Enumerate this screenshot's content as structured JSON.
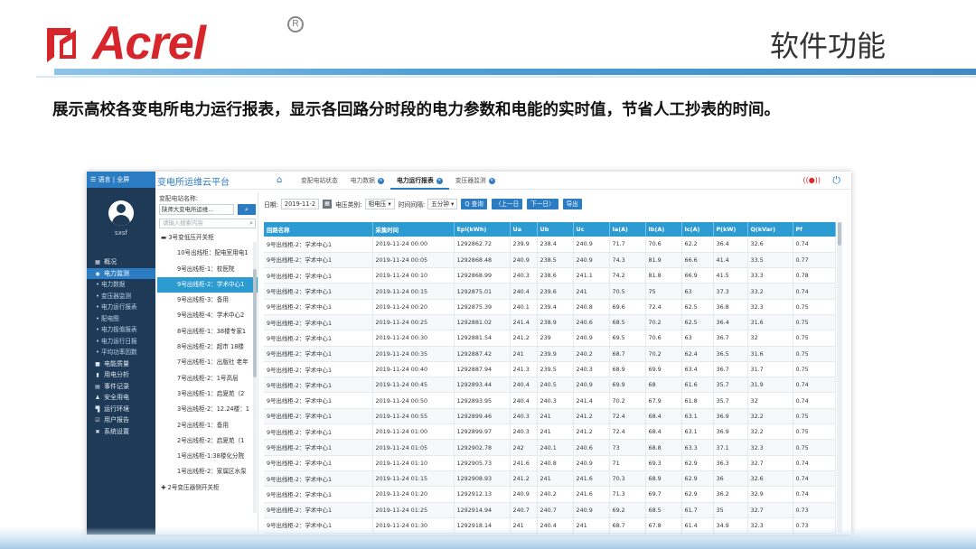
{
  "slide": {
    "logo_text": "Acrel",
    "logo_registered": "R",
    "title": "软件功能",
    "description": "展示高校各变电所电力运行报表，显示各回路分时段的电力参数和电能的实时值，节省人工抄表的时间。",
    "colors": {
      "brand_red": "#d6262b",
      "accent_blue": "#2b7cc3",
      "header_blue": "#2b9bd1",
      "sidebar": "#1f3a56"
    }
  },
  "app": {
    "sidebar": {
      "top_label": "☰ 语言 | 全屏",
      "username": "sxsf",
      "menu": [
        {
          "label": "概况",
          "icon": "dashboard-icon",
          "glyph": "▦",
          "sub": false,
          "active": false
        },
        {
          "label": "电力监测",
          "icon": "monitor-icon",
          "glyph": "◉",
          "sub": false,
          "active": true
        },
        {
          "label": "• 电力数据",
          "icon": "",
          "glyph": "",
          "sub": true,
          "active": false
        },
        {
          "label": "• 变压器监测",
          "icon": "",
          "glyph": "",
          "sub": true,
          "active": false
        },
        {
          "label": "• 电力运行报表",
          "icon": "",
          "glyph": "",
          "sub": true,
          "active": false
        },
        {
          "label": "• 配电图",
          "icon": "",
          "glyph": "",
          "sub": true,
          "active": false
        },
        {
          "label": "• 电力极值报表",
          "icon": "",
          "glyph": "",
          "sub": true,
          "active": false
        },
        {
          "label": "• 电力运行日报",
          "icon": "",
          "glyph": "",
          "sub": true,
          "active": false
        },
        {
          "label": "• 平均功率因数",
          "icon": "",
          "glyph": "",
          "sub": true,
          "active": false
        },
        {
          "label": "电能质量",
          "icon": "power-quality-icon",
          "glyph": "■",
          "sub": false,
          "active": false
        },
        {
          "label": "用电分析",
          "icon": "analysis-icon",
          "glyph": "▮",
          "sub": false,
          "active": false
        },
        {
          "label": "事件记录",
          "icon": "event-icon",
          "glyph": "▤",
          "sub": false,
          "active": false
        },
        {
          "label": "安全用电",
          "icon": "safety-icon",
          "glyph": "♟",
          "sub": false,
          "active": false
        },
        {
          "label": "运行环境",
          "icon": "environment-icon",
          "glyph": "▜",
          "sub": false,
          "active": false
        },
        {
          "label": "用户报告",
          "icon": "report-icon",
          "glyph": "☑",
          "sub": false,
          "active": false
        },
        {
          "label": "系统设置",
          "icon": "settings-icon",
          "glyph": "✖",
          "sub": false,
          "active": false
        }
      ]
    },
    "topbar": {
      "platform_name": "变电所运维云平台",
      "tabs": [
        {
          "label": "变配电站状态",
          "closable": false,
          "active": false
        },
        {
          "label": "电力数据",
          "closable": true,
          "active": false
        },
        {
          "label": "电力运行报表",
          "closable": true,
          "active": true
        },
        {
          "label": "变压器监测",
          "closable": true,
          "active": false
        }
      ]
    },
    "tree": {
      "station_label": "变配电站名称:",
      "station_value": "陕师大变电所运维...",
      "search_placeholder": "请输入搜索内容",
      "nodes": [
        {
          "label": "▬ 3号变低压开关柜",
          "root": true,
          "active": false
        },
        {
          "label": "10号出线柜：配电室用电1",
          "root": false,
          "active": false
        },
        {
          "label": "9号出线柜-1：校医院",
          "root": false,
          "active": false
        },
        {
          "label": "9号出线柜-2：学术中心1",
          "root": false,
          "active": true
        },
        {
          "label": "9号出线柜-3：备用",
          "root": false,
          "active": false
        },
        {
          "label": "9号出线柜-4：学术中心2",
          "root": false,
          "active": false
        },
        {
          "label": "8号出线柜-1：38楼专家1",
          "root": false,
          "active": false
        },
        {
          "label": "8号出线柜-2：超市 18楼",
          "root": false,
          "active": false
        },
        {
          "label": "7号出线柜-1：出版社 老年",
          "root": false,
          "active": false
        },
        {
          "label": "7号出线柜-2：1号高层",
          "root": false,
          "active": false
        },
        {
          "label": "3号出线柜-1：启夏苑（2",
          "root": false,
          "active": false
        },
        {
          "label": "3号出线柜-2：12.24楼：1",
          "root": false,
          "active": false
        },
        {
          "label": "2号出线柜-1：备用",
          "root": false,
          "active": false
        },
        {
          "label": "2号出线柜-2：启夏苑（1",
          "root": false,
          "active": false
        },
        {
          "label": "1号出线柜-1:38楼化分院",
          "root": false,
          "active": false
        },
        {
          "label": "1号出线柜-2：家属区水泵",
          "root": false,
          "active": false
        },
        {
          "label": "✚ 2号变压器侧开关柜",
          "root": true,
          "active": false
        }
      ]
    },
    "toolbar": {
      "date_label": "日期:",
      "date_value": "2019-11-2",
      "type_label": "电压类别:",
      "type_value": "相电压",
      "interval_label": "时间间隔:",
      "interval_value": "五分钟",
      "buttons": [
        "Q 查询",
        "〈上一日",
        "下一日〉",
        "导出"
      ]
    },
    "table": {
      "columns": [
        "回路名称",
        "采集时间",
        "Epi(kWh)",
        "Ua",
        "Ub",
        "Uc",
        "Ia(A)",
        "Ib(A)",
        "Ic(A)",
        "P(kW)",
        "Q(kVar)",
        "Pf"
      ],
      "rows": [
        [
          "9号出线柜-2：学术中心1",
          "2019-11-24 00:00",
          "1292862.72",
          "239.9",
          "238.4",
          "240.9",
          "71.7",
          "70.6",
          "62.2",
          "36.4",
          "32.6",
          "0.74"
        ],
        [
          "9号出线柜-2：学术中心1",
          "2019-11-24 00:05",
          "1292868.48",
          "240.9",
          "238.5",
          "240.9",
          "74.3",
          "81.9",
          "66.6",
          "41.4",
          "33.5",
          "0.77"
        ],
        [
          "9号出线柜-2：学术中心1",
          "2019-11-24 00:10",
          "1292868.99",
          "240.3",
          "238.6",
          "241.1",
          "74.2",
          "81.8",
          "66.9",
          "41.5",
          "33.3",
          "0.78"
        ],
        [
          "9号出线柜-2：学术中心1",
          "2019-11-24 00:15",
          "1292875.01",
          "240.4",
          "239.6",
          "241",
          "70.5",
          "75",
          "63",
          "37.3",
          "33.2",
          "0.74"
        ],
        [
          "9号出线柜-2：学术中心1",
          "2019-11-24 00:20",
          "1292875.39",
          "240.1",
          "239.4",
          "240.8",
          "69.6",
          "72.4",
          "62.5",
          "36.8",
          "32.3",
          "0.75"
        ],
        [
          "9号出线柜-2：学术中心1",
          "2019-11-24 00:25",
          "1292881.02",
          "241.4",
          "238.9",
          "240.6",
          "68.5",
          "70.2",
          "62.5",
          "36.4",
          "31.6",
          "0.75"
        ],
        [
          "9号出线柜-2：学术中心1",
          "2019-11-24 00:30",
          "1292881.54",
          "241.2",
          "239",
          "240.9",
          "69.5",
          "70.6",
          "63",
          "36.7",
          "32",
          "0.75"
        ],
        [
          "9号出线柜-2：学术中心1",
          "2019-11-24 00:35",
          "1292887.42",
          "241",
          "239.9",
          "240.2",
          "68.7",
          "70.2",
          "62.4",
          "36.5",
          "31.6",
          "0.75"
        ],
        [
          "9号出线柜-2：学术中心1",
          "2019-11-24 00:40",
          "1292887.94",
          "241.3",
          "239.5",
          "240.3",
          "68.9",
          "69.9",
          "63.4",
          "36.7",
          "31.7",
          "0.75"
        ],
        [
          "9号出线柜-2：学术中心1",
          "2019-11-24 00:45",
          "1292893.44",
          "240.4",
          "240.5",
          "240.9",
          "69.9",
          "68",
          "61.6",
          "35.7",
          "31.9",
          "0.74"
        ],
        [
          "9号出线柜-2：学术中心1",
          "2019-11-24 00:50",
          "1292893.95",
          "240.4",
          "240.3",
          "241.4",
          "70.2",
          "67.9",
          "61.8",
          "35.7",
          "32",
          "0.74"
        ],
        [
          "9号出线柜-2：学术中心1",
          "2019-11-24 00:55",
          "1292899.46",
          "240.3",
          "241",
          "241.2",
          "72.4",
          "68.4",
          "63.1",
          "36.9",
          "32.2",
          "0.75"
        ],
        [
          "9号出线柜-2：学术中心1",
          "2019-11-24 01:00",
          "1292899.97",
          "240.3",
          "241",
          "241.2",
          "72.4",
          "68.4",
          "63.1",
          "36.9",
          "32.2",
          "0.75"
        ],
        [
          "9号出线柜-2：学术中心1",
          "2019-11-24 01:05",
          "1292902.78",
          "242",
          "240.1",
          "240.6",
          "73",
          "68.8",
          "63.3",
          "37.1",
          "32.3",
          "0.75"
        ],
        [
          "9号出线柜-2：学术中心1",
          "2019-11-24 01:10",
          "1292905.73",
          "241.6",
          "240.8",
          "240.9",
          "71",
          "69.3",
          "62.9",
          "36.3",
          "32.7",
          "0.74"
        ],
        [
          "9号出线柜-2：学术中心1",
          "2019-11-24 01:15",
          "1292908.93",
          "241.2",
          "241",
          "241.6",
          "70.3",
          "68.9",
          "62.9",
          "36",
          "32.6",
          "0.74"
        ],
        [
          "9号出线柜-2：学术中心1",
          "2019-11-24 01:20",
          "1292912.13",
          "240.9",
          "240.2",
          "241.6",
          "71.3",
          "69.7",
          "62.9",
          "36.2",
          "32.9",
          "0.74"
        ],
        [
          "9号出线柜-2：学术中心1",
          "2019-11-24 01:25",
          "1292914.94",
          "240.7",
          "240.7",
          "240.9",
          "69.2",
          "68.5",
          "61.7",
          "35",
          "32.7",
          "0.73"
        ],
        [
          "9号出线柜-2：学术中心1",
          "2019-11-24 01:30",
          "1292918.14",
          "241",
          "240.4",
          "241",
          "68.7",
          "67.8",
          "61.4",
          "34.9",
          "32.3",
          "0.73"
        ]
      ]
    }
  }
}
